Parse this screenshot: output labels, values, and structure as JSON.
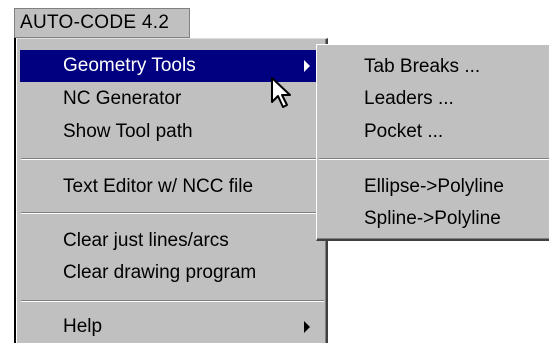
{
  "menubar": {
    "title": "AUTO-CODE 4.2"
  },
  "menu": {
    "items": [
      {
        "label": "Geometry Tools",
        "has_submenu": true,
        "highlighted": true
      },
      {
        "label": "NC Generator"
      },
      {
        "label": "Show Tool path"
      },
      {
        "label": "Text Editor w/ NCC file"
      },
      {
        "label": "Clear just lines/arcs"
      },
      {
        "label": "Clear drawing program"
      },
      {
        "label": "Help",
        "has_submenu": true
      }
    ]
  },
  "submenu": {
    "items": [
      {
        "label": "Tab Breaks ..."
      },
      {
        "label": "Leaders ..."
      },
      {
        "label": "Pocket ..."
      },
      {
        "label": "Ellipse->Polyline"
      },
      {
        "label": "Spline->Polyline"
      }
    ]
  },
  "colors": {
    "menu_face": "#c0c0c0",
    "highlight": "#000080",
    "highlight_text": "#ffffff"
  },
  "icons": {
    "submenu_arrow": "triangle-right-icon",
    "pointer": "arrow-cursor-icon"
  }
}
